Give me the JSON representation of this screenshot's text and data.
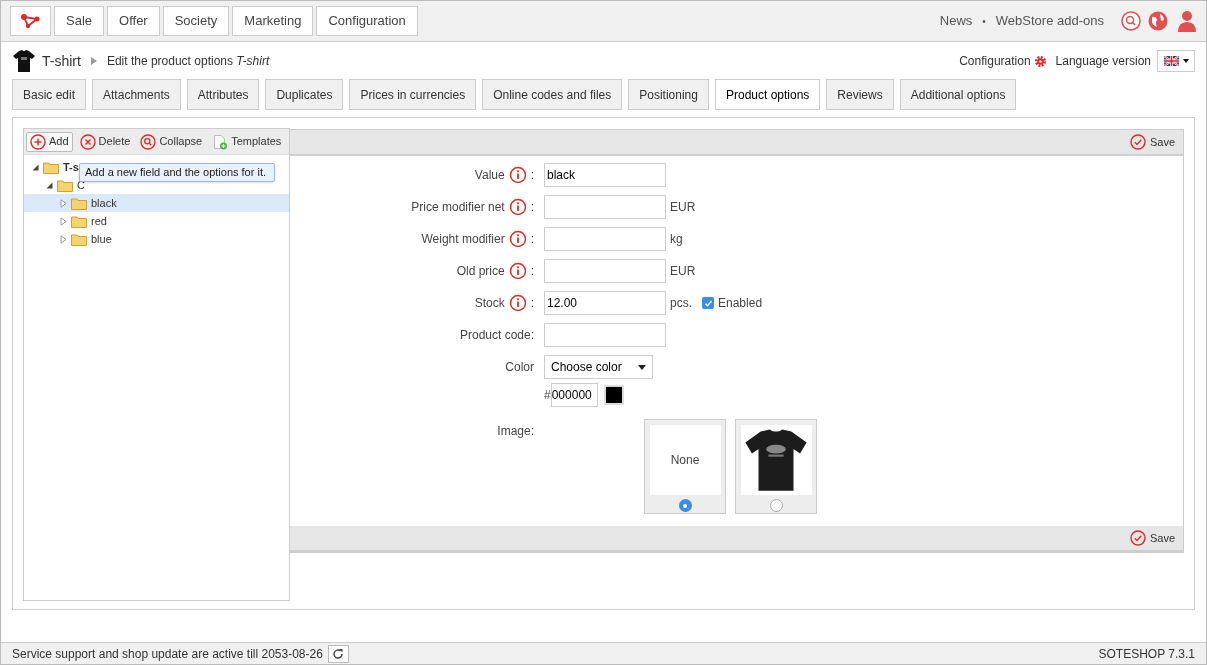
{
  "top_nav": {
    "items": [
      "Sale",
      "Offer",
      "Society",
      "Marketing",
      "Configuration"
    ],
    "links": [
      "News",
      "WebStore add-ons"
    ],
    "separator": "•"
  },
  "breadcrumb": {
    "product": "T-shirt",
    "page": "Edit the product options",
    "page_product": "T-shirt"
  },
  "header_right": {
    "configuration": "Configuration",
    "language_label": "Language version"
  },
  "tabs": [
    {
      "label": "Basic edit",
      "selected": false
    },
    {
      "label": "Attachments",
      "selected": false
    },
    {
      "label": "Attributes",
      "selected": false
    },
    {
      "label": "Duplicates",
      "selected": false
    },
    {
      "label": "Prices in currencies",
      "selected": false
    },
    {
      "label": "Online codes and files",
      "selected": false
    },
    {
      "label": "Positioning",
      "selected": false
    },
    {
      "label": "Product options",
      "selected": true
    },
    {
      "label": "Reviews",
      "selected": false
    },
    {
      "label": "Additional options",
      "selected": false
    }
  ],
  "tree_toolbar": [
    {
      "label": "Add",
      "kind": "add"
    },
    {
      "label": "Delete",
      "kind": "delete"
    },
    {
      "label": "Collapse",
      "kind": "collapse"
    },
    {
      "label": "Templates",
      "kind": "templates"
    }
  ],
  "tooltip": "Add a new field and the options for it.",
  "tree": [
    {
      "label": "T-s",
      "expanded": true,
      "selected": false,
      "children": [
        {
          "label": "C",
          "expanded": true,
          "selected": false,
          "children": [
            {
              "label": "black",
              "expanded": false,
              "selected": true
            },
            {
              "label": "red",
              "expanded": false,
              "selected": false
            },
            {
              "label": "blue",
              "expanded": false,
              "selected": false
            }
          ]
        }
      ]
    }
  ],
  "save_labels": [
    "Save",
    "Save"
  ],
  "form": [
    {
      "kind": "input",
      "label": "Value",
      "info": true,
      "colon": ":",
      "value": "black"
    },
    {
      "kind": "input",
      "label": "Price modifier net",
      "info": true,
      "colon": ":",
      "unit": "EUR"
    },
    {
      "kind": "input",
      "label": "Weight modifier",
      "info": true,
      "colon": ":",
      "unit": "kg"
    },
    {
      "kind": "input",
      "label": "Old price",
      "info": true,
      "colon": ":",
      "unit": "EUR"
    },
    {
      "kind": "input",
      "label": "Stock",
      "info": true,
      "colon": ":",
      "value": "12.00",
      "unit": "pcs.",
      "checkbox": {
        "label": "Enabled",
        "checked": true
      }
    },
    {
      "kind": "input",
      "label": "Product code:",
      "info": false
    },
    {
      "kind": "color",
      "label": "Color",
      "button": "Choose color",
      "hash": "#",
      "value": "000000",
      "color": "#000000"
    },
    {
      "kind": "images",
      "label": "Image:",
      "options": [
        {
          "kind": "text",
          "label": "None",
          "selected": true
        },
        {
          "kind": "picture",
          "selected": false
        }
      ]
    }
  ],
  "status_bar": {
    "message": "Service support and shop update are active till 2053-08-26",
    "version": "SOTESHOP 7.3.1"
  }
}
